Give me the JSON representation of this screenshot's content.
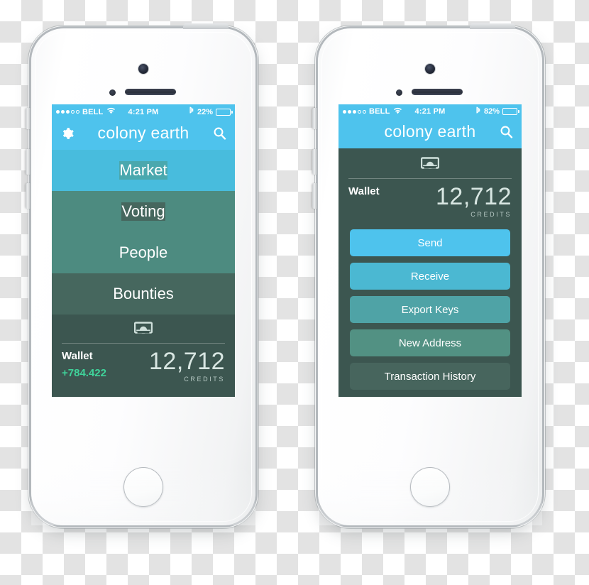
{
  "app": {
    "title": "colony earth",
    "accent_blue": "#4ec3ed",
    "panel_dark": "#3c5650",
    "positive_green": "#3fd39a"
  },
  "left_phone": {
    "status_bar": {
      "carrier": "BELL",
      "signal_filled": 3,
      "signal_total": 5,
      "wifi_icon": "wifi-icon",
      "time": "4:21 PM",
      "bluetooth_icon": "bluetooth-icon",
      "battery_percent": "22%",
      "battery_level": 22
    },
    "nav": {
      "settings_icon": "gear-icon",
      "title": "colony earth",
      "search_icon": "search-icon"
    },
    "menu": [
      {
        "label": "Market",
        "color": "#48bcdd"
      },
      {
        "label": "Voting",
        "color": "#4aa8ae"
      },
      {
        "label": "People",
        "color": "#4d8b80"
      },
      {
        "label": "Bounties",
        "color": "#46675e"
      }
    ],
    "wallet": {
      "icon": "banknote-icon",
      "label": "Wallet",
      "delta": "+784.422",
      "amount": "12,712",
      "unit": "CREDITS"
    }
  },
  "right_phone": {
    "status_bar": {
      "carrier": "BELL",
      "signal_filled": 3,
      "signal_total": 5,
      "wifi_icon": "wifi-icon",
      "time": "4:21 PM",
      "bluetooth_icon": "bluetooth-icon",
      "battery_percent": "82%",
      "battery_level": 82
    },
    "nav": {
      "title": "colony earth",
      "search_icon": "search-icon"
    },
    "wallet": {
      "icon": "banknote-icon",
      "label": "Wallet",
      "amount": "12,712",
      "unit": "CREDITS"
    },
    "actions": [
      {
        "label": "Send",
        "color": "#4ec3ed"
      },
      {
        "label": "Receive",
        "color": "#4bb8d2"
      },
      {
        "label": "Export Keys",
        "color": "#4fa3a6"
      },
      {
        "label": "New Address",
        "color": "#529183"
      },
      {
        "label": "Transaction History",
        "color": "#47655d"
      }
    ]
  }
}
